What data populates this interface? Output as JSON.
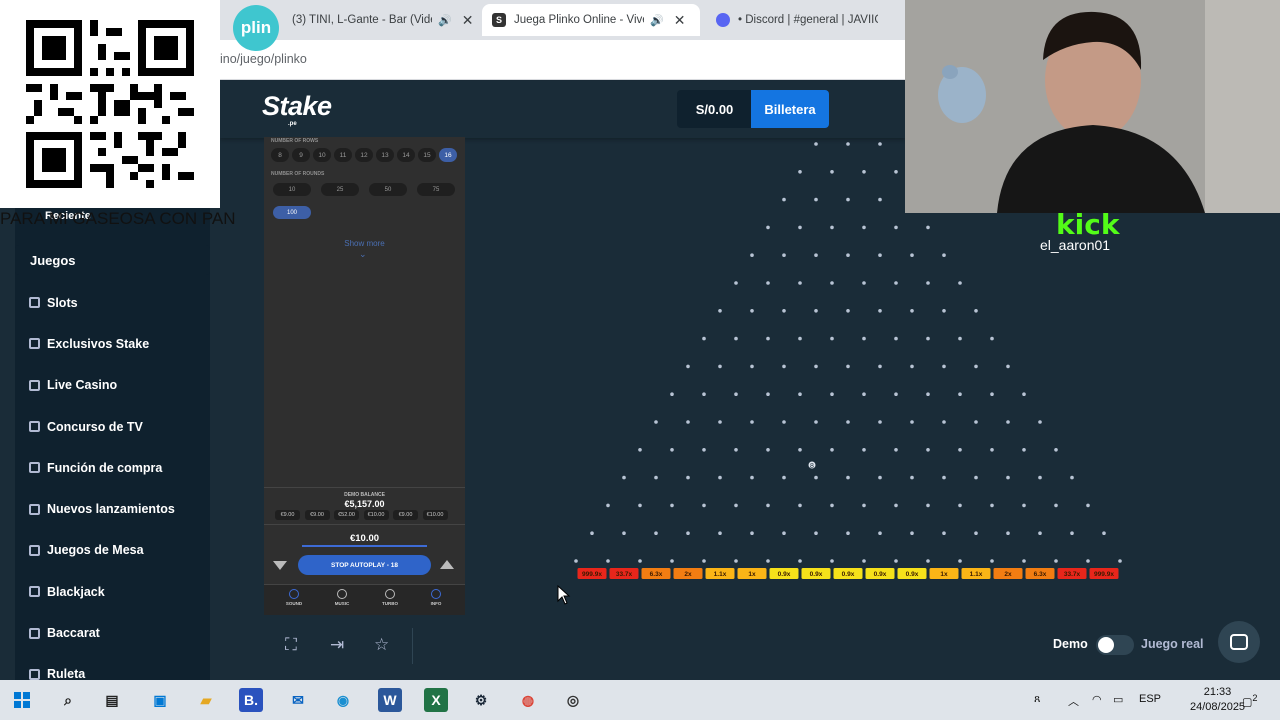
{
  "browser": {
    "tabs": [
      {
        "title": "(3) TINI, L-Gante - Bar (Vide",
        "icon": "youtube-icon",
        "active": false
      },
      {
        "title": "Juega Plinko Online - Vive la",
        "icon": "stake-icon",
        "active": true
      },
      {
        "title": "• Discord | #general | JAVIIG",
        "icon": "discord-icon",
        "active": false
      }
    ],
    "address": "ino/juego/plinko"
  },
  "overlay": {
    "plin_label": "plin",
    "marquee": "PARA MI GASEOSA CON PAN",
    "kick_label": "kick",
    "kick_user": "el_aaron01"
  },
  "header": {
    "logo": "Stake",
    "logo_sub": ".pe",
    "balance": "S/0.00",
    "wallet_button": "Billetera"
  },
  "sidebar": {
    "recent_label": "Reciente",
    "section_label": "Juegos",
    "items": [
      "Slots",
      "Exclusivos Stake",
      "Live Casino",
      "Concurso de TV",
      "Función de compra",
      "Nuevos lanzamientos",
      "Juegos de Mesa",
      "Blackjack",
      "Baccarat",
      "Ruleta"
    ]
  },
  "game_panel": {
    "rows_label": "NUMBER OF ROWS",
    "rows": [
      "8",
      "9",
      "10",
      "11",
      "12",
      "13",
      "14",
      "15",
      "16"
    ],
    "rows_selected": "16",
    "rounds_label": "NUMBER OF ROUNDS",
    "rounds": [
      "10",
      "25",
      "50",
      "75",
      "100"
    ],
    "rounds_selected": "100",
    "show_more": "Show more",
    "demo_label": "DEMO BALANCE",
    "demo_balance": "€5,157.00",
    "chips": [
      "€9.00",
      "€9.00",
      "€52.00",
      "€10.00",
      "€9.00",
      "€10.00"
    ],
    "bet_amount": "€10.00",
    "stop_button": "STOP AUTOPLAY - 18",
    "controls": [
      {
        "label": "SOUND",
        "icon": "sound-icon"
      },
      {
        "label": "MUSIC",
        "icon": "music-icon"
      },
      {
        "label": "TURBO",
        "icon": "turbo-icon"
      },
      {
        "label": "INFO",
        "icon": "info-icon"
      }
    ]
  },
  "board": {
    "multipliers": [
      "999.9x",
      "33.7x",
      "6.3x",
      "2x",
      "1.1x",
      "1x",
      "0.9x",
      "0.9x",
      "0.9x",
      "0.9x",
      "0.9x",
      "1x",
      "1.1x",
      "2x",
      "6.3x",
      "33.7x",
      "999.9x"
    ],
    "ball_label": "8",
    "colors": {
      "hot": "#e8261b",
      "warm": "#f27d12",
      "mid": "#fbb516",
      "cool": "#f6e11a"
    }
  },
  "toolbar": {
    "demo_label": "Demo",
    "real_label": "Juego real"
  },
  "taskbar": {
    "lang": "ESP",
    "time": "21:33",
    "date": "24/08/2025",
    "notifications": "2"
  }
}
